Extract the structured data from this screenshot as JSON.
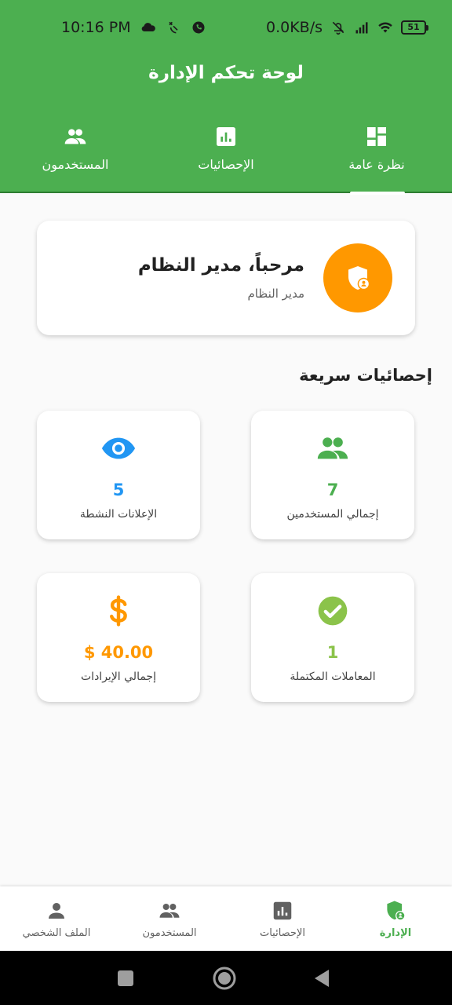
{
  "status_bar": {
    "time": "10:16 PM",
    "net_speed": "0.0KB/s",
    "battery": "51"
  },
  "header": {
    "title": "لوحة تحكم الإدارة"
  },
  "tabs": [
    {
      "label": "نظرة عامة",
      "icon": "dashboard-icon",
      "active": true
    },
    {
      "label": "الإحصائيات",
      "icon": "bar-chart-icon",
      "active": false
    },
    {
      "label": "المستخدمون",
      "icon": "people-icon",
      "active": false
    }
  ],
  "welcome": {
    "title": "مرحباً، مدير النظام",
    "subtitle": "مدير النظام",
    "avatar_icon": "admin-shield-icon",
    "avatar_color": "#ff9800"
  },
  "quick_stats": {
    "title": "إحصائيات سريعة",
    "items": [
      {
        "value": "7",
        "label": "إجمالي المستخدمين",
        "icon": "people-icon",
        "color": "#4caf50"
      },
      {
        "value": "5",
        "label": "الإعلانات النشطة",
        "icon": "eye-icon",
        "color": "#2196f3"
      },
      {
        "value": "1",
        "label": "المعاملات المكتملة",
        "icon": "check-circle-icon",
        "color": "#8bc34a"
      },
      {
        "value": "$ 40.00",
        "label": "إجمالي الإيرادات",
        "icon": "dollar-icon",
        "color": "#ff9800"
      }
    ]
  },
  "bottom_nav": [
    {
      "label": "الإدارة",
      "icon": "admin-shield-icon",
      "active": true
    },
    {
      "label": "الإحصائيات",
      "icon": "bar-chart-icon",
      "active": false
    },
    {
      "label": "المستخدمون",
      "icon": "people-icon",
      "active": false
    },
    {
      "label": "الملف الشخصي",
      "icon": "person-icon",
      "active": false
    }
  ],
  "colors": {
    "primary": "#4caf50",
    "accent_orange": "#ff9800",
    "accent_blue": "#2196f3",
    "accent_lightgreen": "#8bc34a"
  }
}
